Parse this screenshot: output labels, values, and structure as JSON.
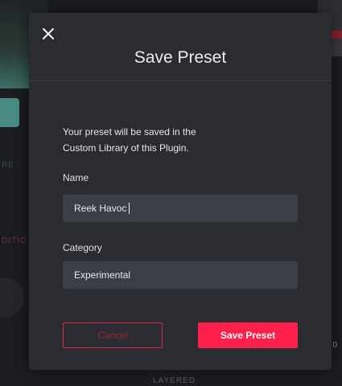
{
  "dialog": {
    "title": "Save Preset",
    "description_line1": "Your preset will be saved in the",
    "description_line2": "Custom Library of this Plugin.",
    "name_label": "Name",
    "name_value": "Reek Havoc",
    "category_label": "Category",
    "category_value": "Experimental",
    "cancel_label": "Cancel",
    "save_label": "Save Preset",
    "close_icon": "close-icon"
  },
  "background": {
    "text_left_a": "RE",
    "text_left_b": "DITIC",
    "text_bottom": "LAYERED",
    "text_right": "0"
  },
  "colors": {
    "accent": "#ff1f4b",
    "modal_bg": "#2a2c32",
    "field_bg": "#3b3e46"
  }
}
